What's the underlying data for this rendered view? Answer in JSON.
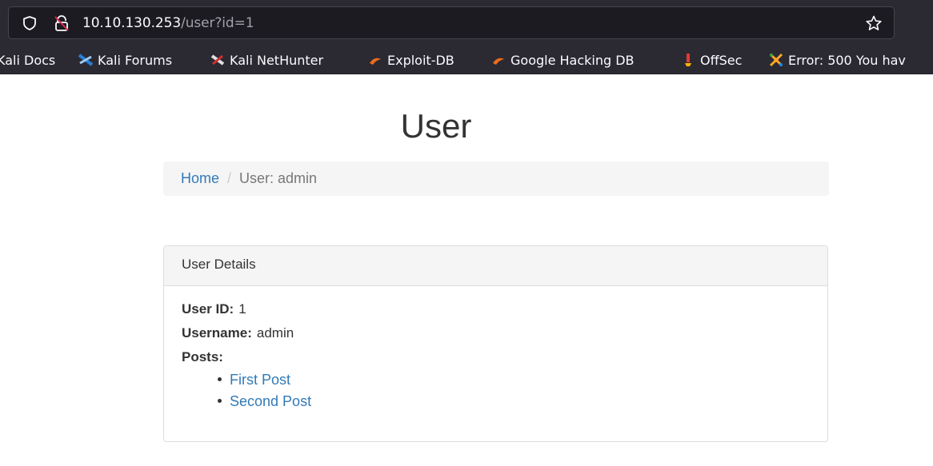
{
  "browser": {
    "url_host": "10.10.130.253",
    "url_path": "/user?id=1",
    "bookmarks": [
      {
        "label": "Kali Docs",
        "icon": "kali-docs-icon"
      },
      {
        "label": "Kali Forums",
        "icon": "kali-forums-icon"
      },
      {
        "label": "Kali NetHunter",
        "icon": "kali-nethunter-icon"
      },
      {
        "label": "Exploit-DB",
        "icon": "exploit-db-icon"
      },
      {
        "label": "Google Hacking DB",
        "icon": "google-hacking-db-icon"
      },
      {
        "label": "OffSec",
        "icon": "offsec-icon"
      },
      {
        "label": "Error: 500 You hav",
        "icon": "error-page-icon"
      }
    ]
  },
  "page": {
    "title": "User",
    "breadcrumb": {
      "home": "Home",
      "separator": "/",
      "current": "User: admin"
    },
    "panel": {
      "heading": "User Details",
      "user_id_label": "User ID:",
      "user_id_value": "1",
      "username_label": "Username:",
      "username_value": "admin",
      "posts_label": "Posts:",
      "posts": [
        "First Post",
        "Second Post"
      ]
    }
  },
  "colors": {
    "chrome_bg": "#2b2a33",
    "urlbar_bg": "#1c1b22",
    "link": "#337ab7",
    "text": "#333333"
  }
}
